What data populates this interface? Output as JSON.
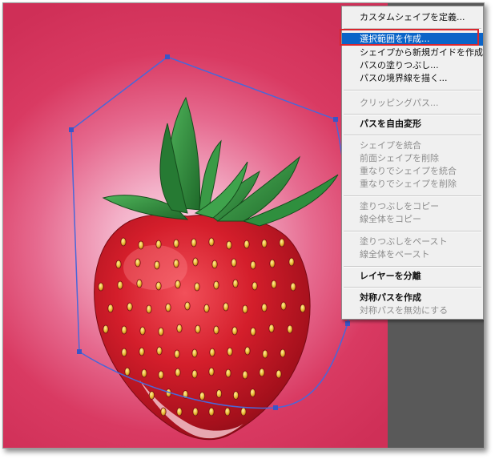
{
  "menu": {
    "items": [
      {
        "label": "カスタムシェイプを定義...",
        "enabled": true
      },
      {
        "label": "選択範囲を作成...",
        "enabled": true,
        "highlighted": true
      },
      {
        "label": "シェイプから新規ガイドを作成",
        "enabled": true
      },
      {
        "label": "パスの塗りつぶし...",
        "enabled": true
      },
      {
        "label": "パスの境界線を描く...",
        "enabled": true
      },
      {
        "label": "クリッピングパス...",
        "enabled": false
      },
      {
        "label": "パスを自由変形",
        "enabled": true
      },
      {
        "label": "シェイプを統合",
        "enabled": false
      },
      {
        "label": "前面シェイプを削除",
        "enabled": false
      },
      {
        "label": "重なりでシェイプを統合",
        "enabled": false
      },
      {
        "label": "重なりでシェイプを削除",
        "enabled": false
      },
      {
        "label": "塗りつぶしをコピー",
        "enabled": false
      },
      {
        "label": "線全体をコピー",
        "enabled": false
      },
      {
        "label": "塗りつぶしをペースト",
        "enabled": false
      },
      {
        "label": "線全体をペースト",
        "enabled": false
      },
      {
        "label": "レイヤーを分離",
        "enabled": true
      },
      {
        "label": "対称パスを作成",
        "enabled": true
      },
      {
        "label": "対称パスを無効にする",
        "enabled": false
      }
    ]
  },
  "colors": {
    "canvas_pink": "#d93a62",
    "path_blue": "#4a67d8",
    "menu_highlight": "#0a64c8",
    "annotation_red": "#d9262e",
    "strawberry_red": "#d41e2b",
    "leaf_green": "#2f8f3e"
  },
  "canvas": {
    "subject": "strawberry-image",
    "path_anchor_count": 6
  }
}
